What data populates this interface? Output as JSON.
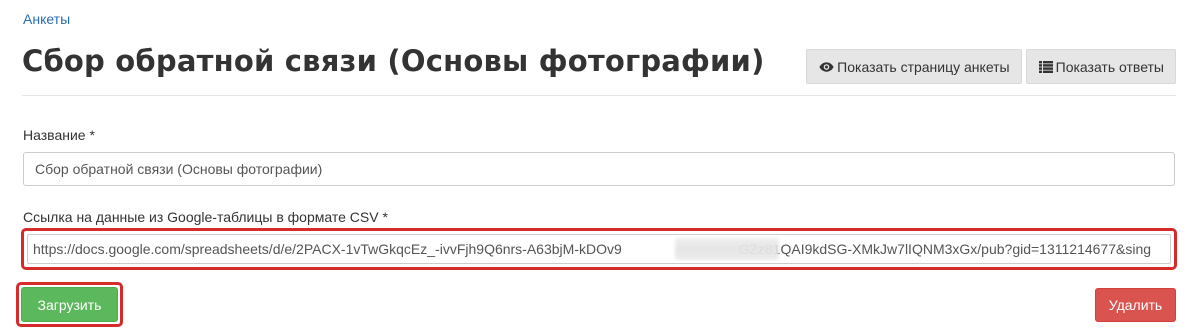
{
  "breadcrumb": {
    "label": "Анкеты"
  },
  "page": {
    "title": "Сбор обратной связи (Основы фотографии)"
  },
  "header_actions": {
    "show_page_label": "Показать страницу анкеты",
    "show_page_icon": "eye-icon",
    "show_answers_label": "Показать ответы",
    "show_answers_icon": "list-icon"
  },
  "form": {
    "name_label": "Название *",
    "name_value": "Сбор обратной связи (Основы фотографии)",
    "csv_label": "Ссылка на данные из Google-таблицы в формате CSV *",
    "csv_value": "https://docs.google.com/spreadsheets/d/e/2PACX-1vTwGkqcEz_-ivvFjh9Q6nrs-A63bjM-kDOv9                              GZz81QAI9kdSG-XMkJw7lIQNM3xGx/pub?gid=1311214677&sing"
  },
  "buttons": {
    "load_label": "Загрузить",
    "delete_label": "Удалить"
  },
  "colors": {
    "link": "#2a6db5",
    "success": "#5cb85c",
    "danger": "#d9534f",
    "highlight": "#d62b2b",
    "default_button": "#e6e6e6"
  }
}
